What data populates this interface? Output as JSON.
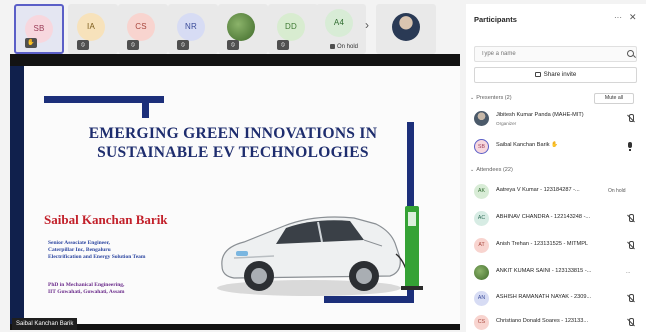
{
  "gallery": {
    "tiles": [
      {
        "initials": "SB",
        "bg": "#f7d7de",
        "fg": "#9a3b56"
      },
      {
        "initials": "IA",
        "bg": "#f7e2bb",
        "fg": "#7a5a1a"
      },
      {
        "initials": "CS",
        "bg": "#f8d4cf",
        "fg": "#a8463d"
      },
      {
        "initials": "NR",
        "bg": "#d7dcf4",
        "fg": "#3b4c9a"
      },
      {
        "initials": "",
        "bg": "#5c8a3c",
        "fg": "#ffffff"
      },
      {
        "initials": "DD",
        "bg": "#d8ecd0",
        "fg": "#3f7a34"
      },
      {
        "initials": "A4",
        "bg": "#d8ecd6",
        "fg": "#2e6a2e",
        "status": "On hold"
      }
    ]
  },
  "slide": {
    "title": "EMERGING GREEN INNOVATIONS IN SUSTAINABLE EV TECHNOLOGIES",
    "presenter": "Saibal Kanchan Barik",
    "role_lines": [
      "Senior Associate Engineer,",
      "Caterpillar Inc, Bengaluru",
      "Electrification and Energy Solution Team"
    ],
    "degree_lines": [
      "PhD in Mechanical Engineering,",
      "IIT Guwahati, Guwahati, Assam"
    ],
    "name_chip": "Saibal Kanchan Barik"
  },
  "participants": {
    "title": "Participants",
    "search_placeholder": "Type a name",
    "share_label": "Share invite",
    "presenters_label": "Presenters (2)",
    "mute_all_label": "Mute all",
    "attendees_label": "Attendees (22)",
    "presenters": [
      {
        "name": "Jibitesh Kumar Panda (MAHE-MIT)",
        "role": "Organizer",
        "initials": "",
        "bg": "#5a6a7a",
        "fg": "#ffffff",
        "mic": "off"
      },
      {
        "name": "Saibal Kanchan Barik",
        "role": "",
        "initials": "SB",
        "bg": "#f7d7de",
        "fg": "#9a3b56",
        "mic": "on"
      }
    ],
    "attendees": [
      {
        "name": "Aatreya V Kumar - 123184287 -...",
        "initials": "AK",
        "bg": "#d8ecd6",
        "fg": "#2e6a2e",
        "status": "On hold",
        "mic": "none"
      },
      {
        "name": "ABHINAV CHANDRA - 122143248 -...",
        "initials": "AC",
        "bg": "#d7ece4",
        "fg": "#2e6a55",
        "status": "",
        "mic": "off"
      },
      {
        "name": "Anish Trehan - 123131525 - MITMPL",
        "initials": "AT",
        "bg": "#f8d4cf",
        "fg": "#a8463d",
        "status": "",
        "mic": "off"
      },
      {
        "name": "ANKIT KUMAR SAINI - 123133815 -...",
        "initials": "",
        "bg": "#5c8a3c",
        "fg": "#ffffff",
        "status": "...",
        "mic": "none"
      },
      {
        "name": "ASHISH RAMANATH NAYAK - 2309...",
        "initials": "AN",
        "bg": "#d7dcf4",
        "fg": "#3b4c9a",
        "status": "",
        "mic": "off"
      },
      {
        "name": "Christiano Donald Soares - 123133...",
        "initials": "CS",
        "bg": "#f8d4cf",
        "fg": "#a8463d",
        "status": "",
        "mic": "off"
      }
    ]
  }
}
